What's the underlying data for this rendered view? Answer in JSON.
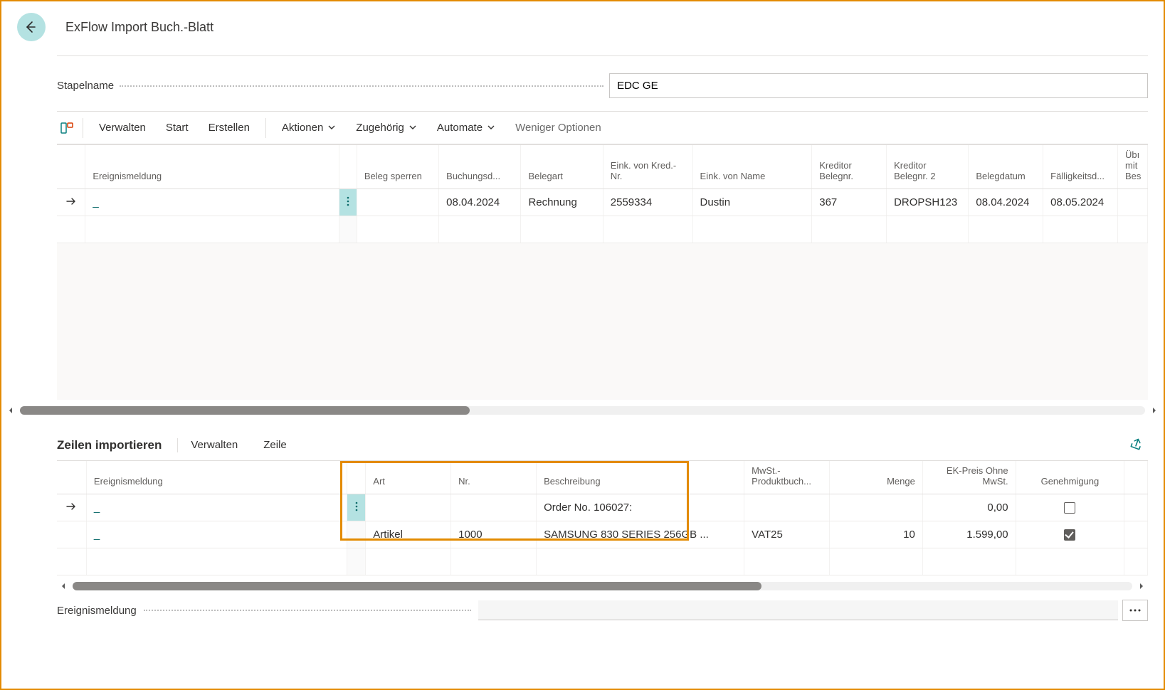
{
  "page_title": "ExFlow Import Buch.-Blatt",
  "batch": {
    "label": "Stapelname",
    "value": "EDC GE"
  },
  "toolbar": {
    "manage": "Verwalten",
    "start": "Start",
    "create": "Erstellen",
    "actions": "Aktionen",
    "related": "Zugehörig",
    "automate": "Automate",
    "fewer_options": "Weniger Optionen"
  },
  "main_grid": {
    "headers": {
      "event": "Ereignismeldung",
      "lock": "Beleg sperren",
      "posting_date": "Buchungsd...",
      "doc_type": "Belegart",
      "buy_from_no": "Eink. von Kred.-Nr.",
      "buy_from_name": "Eink. von Name",
      "vendor_doc_no": "Kreditor Belegnr.",
      "vendor_doc_no2": "Kreditor Belegnr. 2",
      "doc_date": "Belegdatum",
      "due_date": "Fälligkeitsd...",
      "extra": "Übı mit Bes"
    },
    "rows": [
      {
        "event": "_",
        "lock": "",
        "posting_date": "08.04.2024",
        "doc_type": "Rechnung",
        "buy_from_no": "2559334",
        "buy_from_name": "Dustin",
        "vendor_doc_no": "367",
        "vendor_doc_no2": "DROPSH123",
        "doc_date": "08.04.2024",
        "due_date": "08.05.2024"
      }
    ]
  },
  "lines": {
    "title": "Zeilen importieren",
    "manage": "Verwalten",
    "line": "Zeile",
    "headers": {
      "event": "Ereignismeldung",
      "type": "Art",
      "no": "Nr.",
      "description": "Beschreibung",
      "vat_group": "MwSt.-Produktbuch...",
      "qty": "Menge",
      "unit_cost": "EK-Preis Ohne MwSt.",
      "approval": "Genehmigung"
    },
    "rows": [
      {
        "event": "_",
        "type": "",
        "no": "",
        "description": "Order No. 106027:",
        "vat_group": "",
        "qty": "",
        "unit_cost": "0,00",
        "approved": false
      },
      {
        "event": "_",
        "type": "Artikel",
        "no": "1000",
        "description": "SAMSUNG 830 SERIES 256GB ...",
        "vat_group": "VAT25",
        "qty": "10",
        "unit_cost": "1.599,00",
        "approved": true
      }
    ]
  },
  "footer": {
    "label": "Ereignismeldung"
  }
}
